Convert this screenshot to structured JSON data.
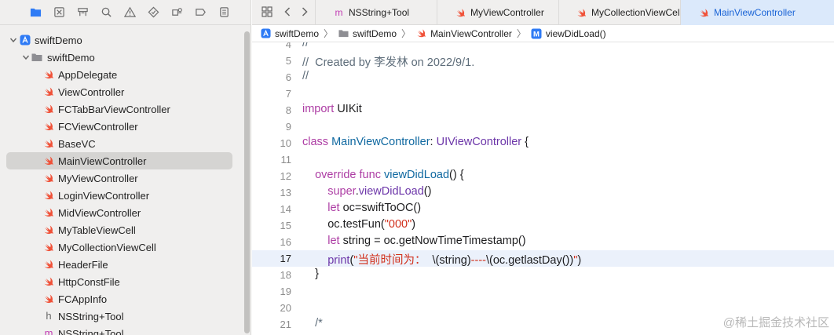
{
  "navigator": {
    "toolbar_icons": [
      "folder-icon",
      "source-control-icon",
      "symbol-icon",
      "find-icon",
      "issue-icon",
      "test-icon",
      "debug-icon",
      "breakpoint-icon",
      "report-icon"
    ],
    "project": "swiftDemo",
    "group": "swiftDemo",
    "files": [
      {
        "name": "AppDelegate",
        "kind": "swift"
      },
      {
        "name": "ViewController",
        "kind": "swift"
      },
      {
        "name": "FCTabBarViewController",
        "kind": "swift"
      },
      {
        "name": "FCViewController",
        "kind": "swift"
      },
      {
        "name": "BaseVC",
        "kind": "swift"
      },
      {
        "name": "MainViewController",
        "kind": "swift",
        "selected": true
      },
      {
        "name": "MyViewController",
        "kind": "swift"
      },
      {
        "name": "LoginViewController",
        "kind": "swift"
      },
      {
        "name": "MidViewController",
        "kind": "swift"
      },
      {
        "name": "MyTableViewCell",
        "kind": "swift"
      },
      {
        "name": "MyCollectionViewCell",
        "kind": "swift"
      },
      {
        "name": "HeaderFile",
        "kind": "swift"
      },
      {
        "name": "HttpConstFile",
        "kind": "swift"
      },
      {
        "name": "FCAppInfo",
        "kind": "swift"
      },
      {
        "name": "NSString+Tool",
        "kind": "h"
      },
      {
        "name": "NSString+Tool",
        "kind": "m"
      }
    ]
  },
  "tabs": [
    {
      "label": "NSString+Tool",
      "kind": "m"
    },
    {
      "label": "MyViewController",
      "kind": "swift"
    },
    {
      "label": "MyCollectionViewCell",
      "kind": "swift"
    },
    {
      "label": "MainViewController",
      "kind": "swift",
      "active": true
    }
  ],
  "jumpbar": {
    "project": "swiftDemo",
    "group": "swiftDemo",
    "file": "MainViewController",
    "symbol": "viewDidLoad()",
    "symbol_badge": "M"
  },
  "editor": {
    "current_line": 17,
    "lines": [
      {
        "n": "4",
        "tokens": [
          {
            "t": "//",
            "c": "comment"
          }
        ]
      },
      {
        "n": "5",
        "tokens": [
          {
            "t": "//  Created by 李发林 on 2022/9/1.",
            "c": "comment"
          }
        ]
      },
      {
        "n": "6",
        "tokens": [
          {
            "t": "//",
            "c": "comment"
          }
        ]
      },
      {
        "n": "7",
        "tokens": []
      },
      {
        "n": "8",
        "tokens": [
          {
            "t": "import",
            "c": "kw"
          },
          {
            "t": " UIKit",
            "c": ""
          }
        ]
      },
      {
        "n": "9",
        "tokens": []
      },
      {
        "n": "10",
        "tokens": [
          {
            "t": "class",
            "c": "kw"
          },
          {
            "t": " ",
            "c": ""
          },
          {
            "t": "MainViewController",
            "c": "decl"
          },
          {
            "t": ": ",
            "c": ""
          },
          {
            "t": "UIViewController",
            "c": "sys"
          },
          {
            "t": " {",
            "c": ""
          }
        ]
      },
      {
        "n": "11",
        "tokens": []
      },
      {
        "n": "12",
        "tokens": [
          {
            "t": "    override",
            "c": "kw"
          },
          {
            "t": " ",
            "c": ""
          },
          {
            "t": "func",
            "c": "kw"
          },
          {
            "t": " ",
            "c": ""
          },
          {
            "t": "viewDidLoad",
            "c": "decl"
          },
          {
            "t": "() {",
            "c": ""
          }
        ]
      },
      {
        "n": "13",
        "tokens": [
          {
            "t": "        ",
            "c": ""
          },
          {
            "t": "super",
            "c": "kw"
          },
          {
            "t": ".",
            "c": ""
          },
          {
            "t": "viewDidLoad",
            "c": "sys"
          },
          {
            "t": "()",
            "c": ""
          }
        ]
      },
      {
        "n": "14",
        "tokens": [
          {
            "t": "        ",
            "c": ""
          },
          {
            "t": "let",
            "c": "kw"
          },
          {
            "t": " oc=swiftToOC()",
            "c": ""
          }
        ]
      },
      {
        "n": "15",
        "tokens": [
          {
            "t": "        oc.testFun(",
            "c": ""
          },
          {
            "t": "\"000\"",
            "c": "str"
          },
          {
            "t": ")",
            "c": ""
          }
        ]
      },
      {
        "n": "16",
        "tokens": [
          {
            "t": "        ",
            "c": ""
          },
          {
            "t": "let",
            "c": "kw"
          },
          {
            "t": " string = oc.getNowTimeTimestamp()",
            "c": ""
          }
        ]
      },
      {
        "n": "17",
        "tokens": [
          {
            "t": "        ",
            "c": ""
          },
          {
            "t": "print",
            "c": "sys"
          },
          {
            "t": "(",
            "c": ""
          },
          {
            "t": "\"当前时间为：  ",
            "c": "str"
          },
          {
            "t": "\\(string)",
            "c": ""
          },
          {
            "t": "----",
            "c": "str"
          },
          {
            "t": "\\(oc.getlastDay())",
            "c": ""
          },
          {
            "t": "\"",
            "c": "str"
          },
          {
            "t": ")",
            "c": ""
          }
        ]
      },
      {
        "n": "18",
        "tokens": [
          {
            "t": "    }",
            "c": ""
          }
        ]
      },
      {
        "n": "19",
        "tokens": []
      },
      {
        "n": "20",
        "tokens": []
      },
      {
        "n": "21",
        "tokens": [
          {
            "t": "    /*",
            "c": "comment"
          }
        ]
      }
    ]
  },
  "watermark": "@稀土掘金技术社区",
  "colors": {
    "swift_icon": "#f05138",
    "m_icon": "#c23cb4",
    "h_icon": "#666666",
    "active_tab": "#1a64d6",
    "keyword": "#ad3da4",
    "string": "#d12f1b"
  }
}
